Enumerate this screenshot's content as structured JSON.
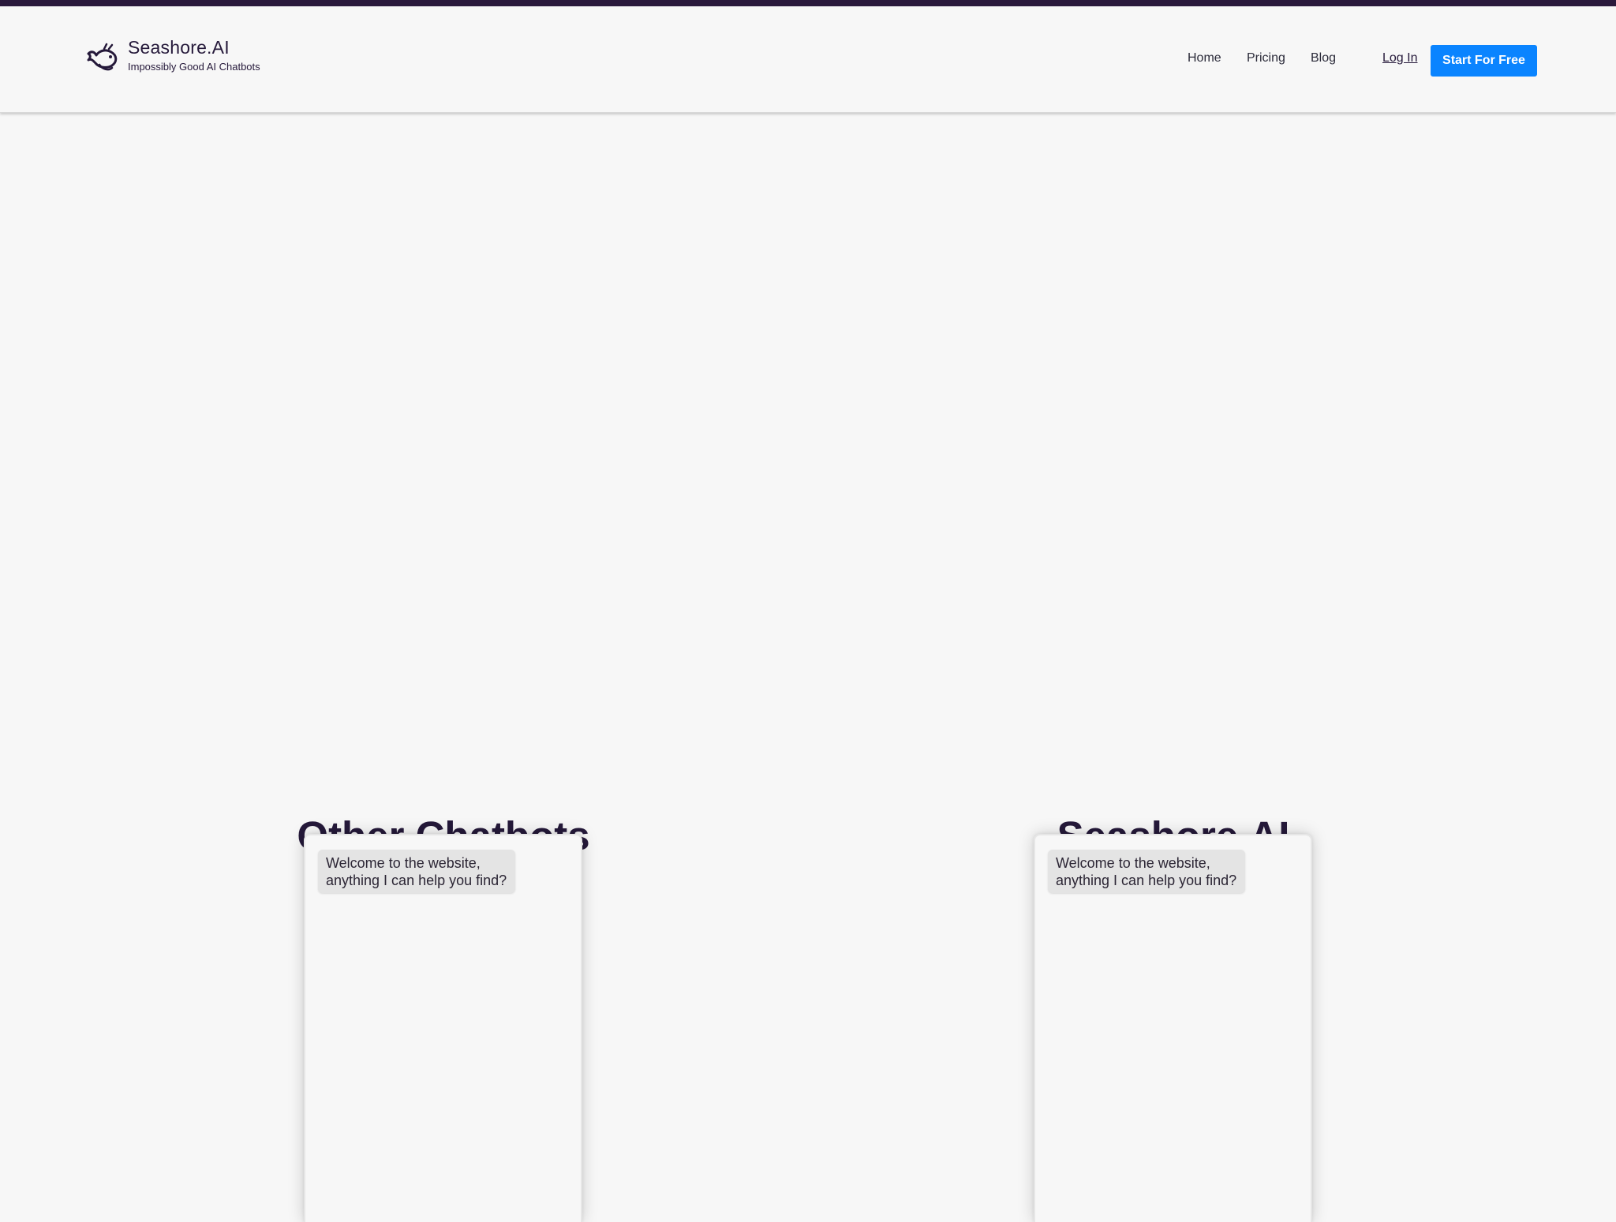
{
  "header": {
    "brand_name": "Seashore.AI",
    "tagline": "Impossibly Good AI Chatbots",
    "logo_icon": "whale-icon",
    "nav": {
      "home": "Home",
      "pricing": "Pricing",
      "blog": "Blog",
      "login": "Log In",
      "cta": "Start For Free"
    },
    "accent_color": "#0a84ff",
    "top_strip_color": "#2a1a3c"
  },
  "comparison": {
    "left": {
      "title": "Other Chatbots",
      "message": "Welcome to the website, anything I can help you find?"
    },
    "right": {
      "title": "Seashore.AI",
      "message": "Welcome to the website, anything I can help you find?"
    }
  }
}
